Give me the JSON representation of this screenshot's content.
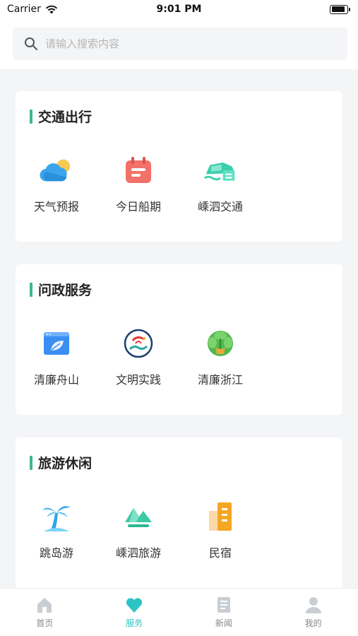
{
  "status": {
    "carrier": "Carrier",
    "time": "9:01 PM"
  },
  "search": {
    "placeholder": "请输入搜索内容"
  },
  "sections": [
    {
      "title": "交通出行",
      "items": [
        {
          "label": "天气预报",
          "icon": "weather-icon"
        },
        {
          "label": "今日船期",
          "icon": "calendar-icon"
        },
        {
          "label": "嵊泗交通",
          "icon": "ferry-icon"
        }
      ]
    },
    {
      "title": "问政服务",
      "items": [
        {
          "label": "清廉舟山",
          "icon": "leaf-window-icon"
        },
        {
          "label": "文明实践",
          "icon": "civilization-logo-icon"
        },
        {
          "label": "清廉浙江",
          "icon": "lotus-icon"
        }
      ]
    },
    {
      "title": "旅游休闲",
      "items": [
        {
          "label": "跳岛游",
          "icon": "palm-island-icon"
        },
        {
          "label": "嵊泗旅游",
          "icon": "mountain-icon"
        },
        {
          "label": "民宿",
          "icon": "building-icon"
        }
      ]
    }
  ],
  "tabs": [
    {
      "label": "首页",
      "icon": "home-icon"
    },
    {
      "label": "服务",
      "icon": "heart-icon",
      "active": true
    },
    {
      "label": "新闻",
      "icon": "news-icon"
    },
    {
      "label": "我的",
      "icon": "profile-icon"
    }
  ],
  "colors": {
    "accent": "#2ec4c4",
    "section_bar": "#3fb68e",
    "background": "#f4f5f7"
  }
}
